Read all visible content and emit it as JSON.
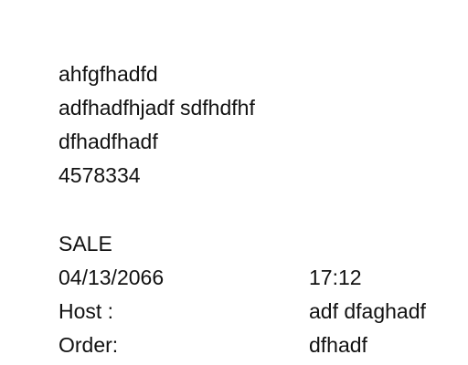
{
  "header": {
    "lines": [
      "ahfgfhadfd",
      "adfhadfhjadf sdfhdfhf",
      "dfhadfhadf",
      "4578334"
    ]
  },
  "transaction": {
    "type": "SALE",
    "date": "04/13/2066",
    "time": "17:12",
    "host_label": "Host :",
    "host_value": "adf dfaghadf",
    "order_label": "Order:",
    "order_value": "dfhadf"
  }
}
